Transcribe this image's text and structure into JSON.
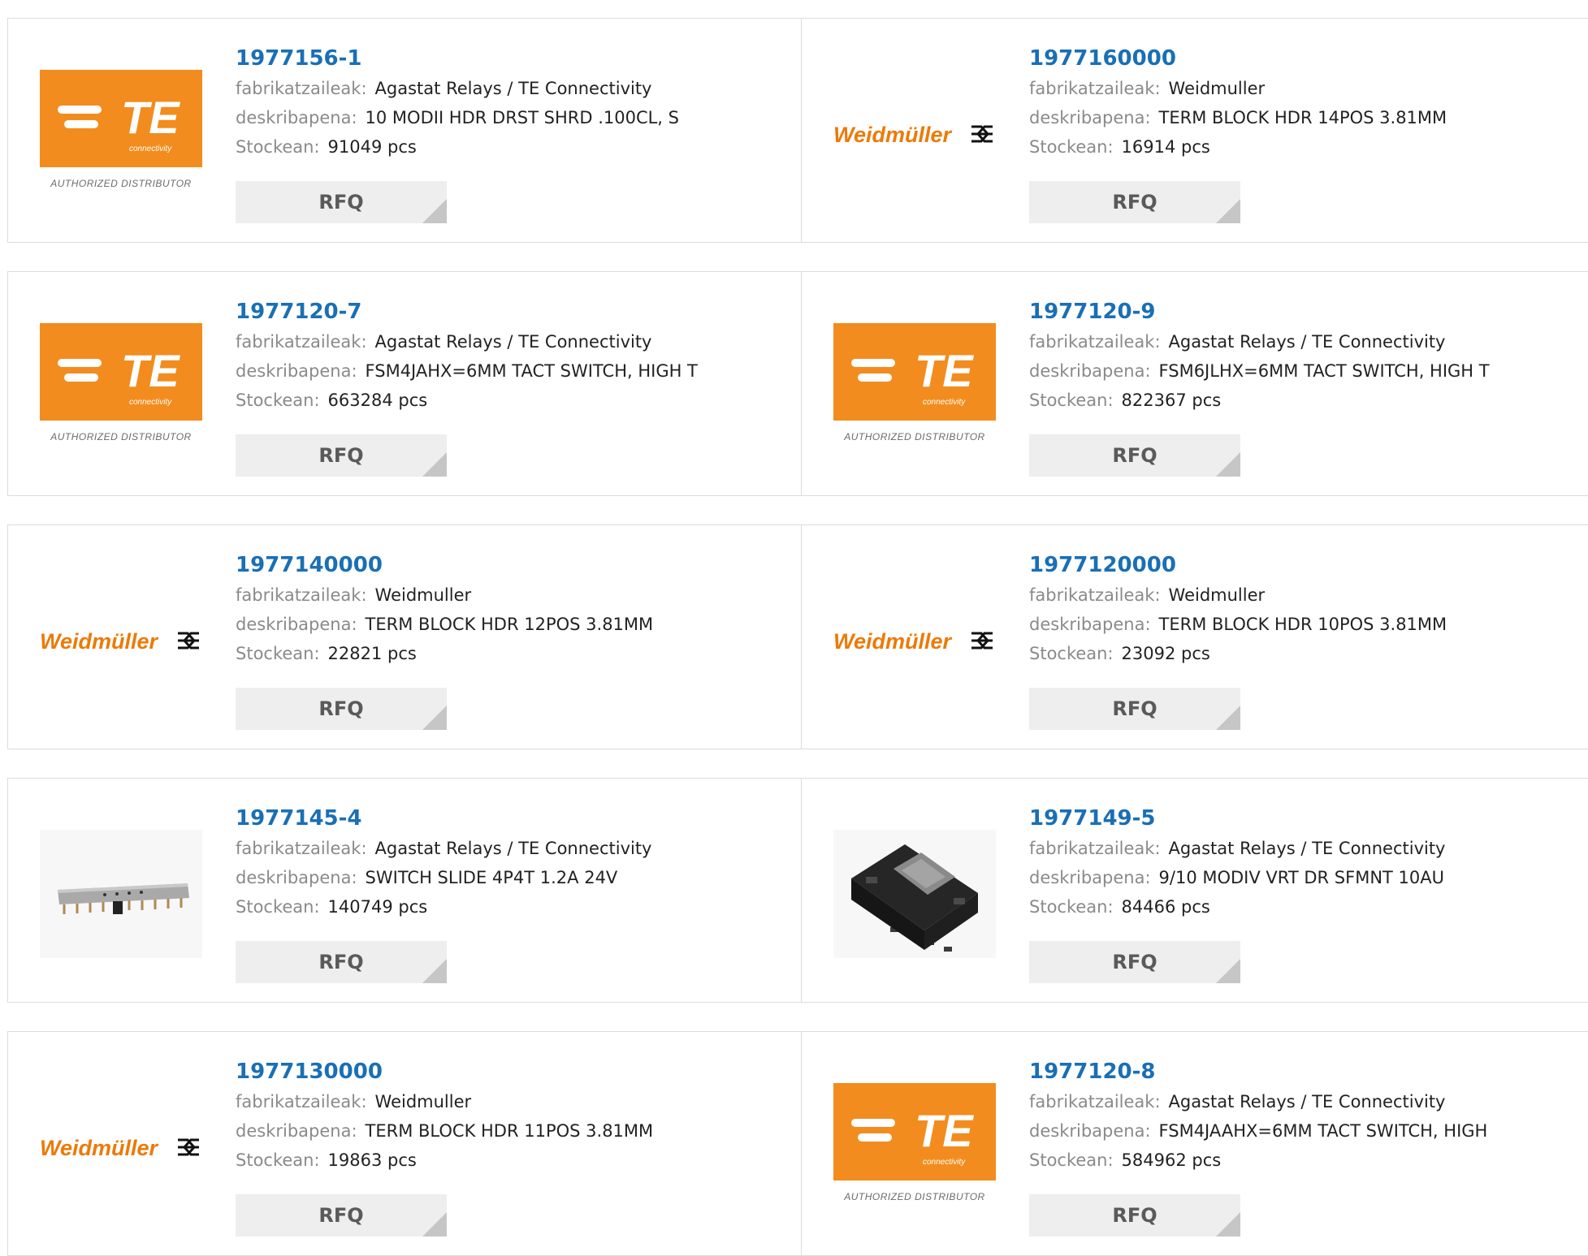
{
  "labels": {
    "manufacturer": "fabrikatzaileak:",
    "description": "deskribapena:",
    "stock": "Stockean:",
    "rfq": "RFQ"
  },
  "logos": {
    "te": {
      "wordmark": "TE",
      "subtext": "connectivity",
      "caption": "AUTHORIZED DISTRIBUTOR",
      "color": "#f28c1e"
    },
    "weidmuller": {
      "wordmark": "Weidmüller",
      "color": "#ec7a08"
    }
  },
  "products": [
    {
      "part": "1977156-1",
      "manufacturer": "Agastat Relays / TE Connectivity",
      "description": "10 MODII HDR DRST SHRD .100CL, S",
      "stock": "91049 pcs",
      "logo": "te-logo"
    },
    {
      "part": "1977160000",
      "manufacturer": "Weidmuller",
      "description": "TERM BLOCK HDR 14POS 3.81MM",
      "stock": "16914 pcs",
      "logo": "weidmuller-logo"
    },
    {
      "part": "1977120-7",
      "manufacturer": "Agastat Relays / TE Connectivity",
      "description": "FSM4JAHX=6MM TACT SWITCH, HIGH T",
      "stock": "663284 pcs",
      "logo": "te-logo"
    },
    {
      "part": "1977120-9",
      "manufacturer": "Agastat Relays / TE Connectivity",
      "description": "FSM6JLHX=6MM TACT SWITCH, HIGH T",
      "stock": "822367 pcs",
      "logo": "te-logo"
    },
    {
      "part": "1977140000",
      "manufacturer": "Weidmuller",
      "description": "TERM BLOCK HDR 12POS 3.81MM",
      "stock": "22821 pcs",
      "logo": "weidmuller-logo"
    },
    {
      "part": "1977120000",
      "manufacturer": "Weidmuller",
      "description": "TERM BLOCK HDR 10POS 3.81MM",
      "stock": "23092 pcs",
      "logo": "weidmuller-logo"
    },
    {
      "part": "1977145-4",
      "manufacturer": "Agastat Relays / TE Connectivity",
      "description": "SWITCH SLIDE 4P4T 1.2A 24V",
      "stock": "140749 pcs",
      "logo": "slide-switch-photo"
    },
    {
      "part": "1977149-5",
      "manufacturer": "Agastat Relays / TE Connectivity",
      "description": "9/10 MODIV VRT DR SFMNT 10AU",
      "stock": "84466 pcs",
      "logo": "connector-photo"
    },
    {
      "part": "1977130000",
      "manufacturer": "Weidmuller",
      "description": "TERM BLOCK HDR 11POS 3.81MM",
      "stock": "19863 pcs",
      "logo": "weidmuller-logo"
    },
    {
      "part": "1977120-8",
      "manufacturer": "Agastat Relays / TE Connectivity",
      "description": "FSM4JAAHX=6MM TACT SWITCH, HIGH",
      "stock": "584962 pcs",
      "logo": "te-logo"
    }
  ]
}
